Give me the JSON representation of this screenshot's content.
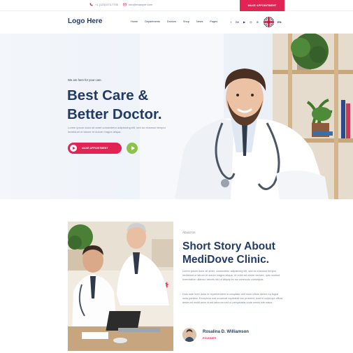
{
  "topbar": {
    "phone": "+1 (123) 673-7700",
    "email": "info@example.com",
    "appointment_label": "MAKE APPOINTMENT"
  },
  "header": {
    "logo": "Logo Here",
    "nav": [
      "Home",
      "Departments",
      "Doctors",
      "Shop",
      "News",
      "Pages"
    ],
    "social_icons": [
      "facebook-icon",
      "behance-icon",
      "youtube-icon",
      "instagram-icon",
      "pinterest-icon"
    ],
    "language": "EN"
  },
  "hero": {
    "eyebrow": "We are here for your care.",
    "title_line1": "Best Care &",
    "title_line2": "Better Doctor.",
    "description": "Lorem ipsum dolor sit amet consectetur adipisicing elit, sed do eiusmod tempor incididunt ut labore et dolore magna aliqua.",
    "button_label": "MAKE APPOINTMENT"
  },
  "about": {
    "eyebrow": "About Us",
    "title_line1": "Short Story About",
    "title_line2": "MediDove Clinic.",
    "para1": "Lorem ipsum dolor sit amet, consectetur adipisicing elit, sed do eiusmod tempor incididunt ut labore et dolore magna aliqua. Ut enim ad minim veniam, quis nostrud exercitation ullamco laboris nisi ut aliquip ex ea commodo consequat.",
    "para2": "Duis aute irure dolor in reprehenderit in voluptate velit esse cillum dolore eu fugiat nulla pariatur. Excepteur sint occaecat cupidatat non proident, sunt in culpa qui officia deserunt mollit anim id est laborum sed ut perspiciatis unde omnis iste natus.",
    "person_name": "Rosalina D. Williamson",
    "person_role": "FOUNDER"
  },
  "colors": {
    "accent": "#e12454",
    "navy": "#223a66",
    "green": "#8bc34a"
  }
}
